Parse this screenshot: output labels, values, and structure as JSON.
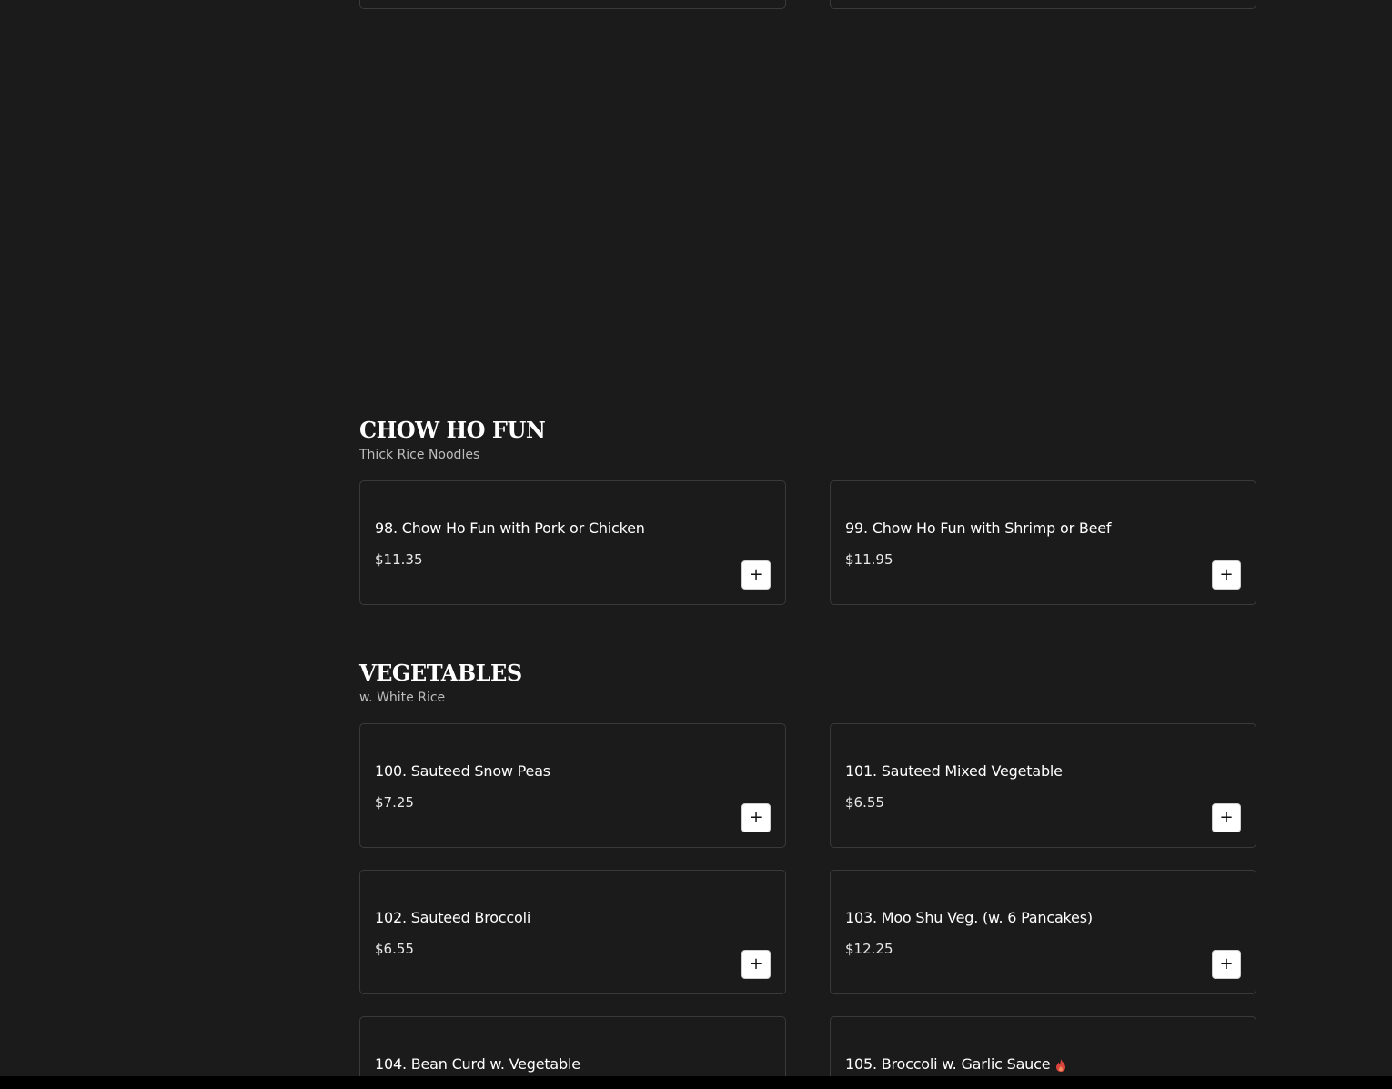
{
  "sections": [
    {
      "title": "CHOW HO FUN",
      "subtitle": "Thick Rice Noodles",
      "items": [
        {
          "name": "98. Chow Ho Fun with Pork or Chicken",
          "price": "$11.35",
          "add": "+"
        },
        {
          "name": "99. Chow Ho Fun with Shrimp or Beef",
          "price": "$11.95",
          "add": "+"
        }
      ]
    },
    {
      "title": "VEGETABLES",
      "subtitle": "w. White Rice",
      "items": [
        {
          "name": "100. Sauteed Snow Peas",
          "price": "$7.25",
          "add": "+"
        },
        {
          "name": "101. Sauteed Mixed Vegetable",
          "price": "$6.55",
          "add": "+"
        },
        {
          "name": "102. Sauteed Broccoli",
          "price": "$6.55",
          "add": "+"
        },
        {
          "name": "103. Moo Shu Veg. (w. 6 Pancakes)",
          "price": "$12.25",
          "add": "+"
        },
        {
          "name": "104. Bean Curd w. Vegetable"
        },
        {
          "name": "105. Broccoli w. Garlic Sauce",
          "icon": "spicy-flame-icon"
        }
      ]
    }
  ],
  "colors": {
    "background": "#1b1b1b",
    "card_border": "#3a3a3a",
    "spicy": "#d9443b"
  }
}
